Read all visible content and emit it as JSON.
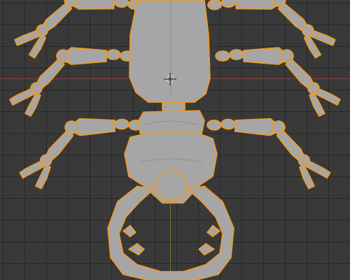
{
  "viewport": {
    "background_color": "#393939",
    "grid_color": "#2e2e2e",
    "x_axis_color": "#8b3a3a",
    "y_axis_color": "#5e7f36"
  },
  "selection": {
    "outline_color": "#f39a1e",
    "mesh_color": "#a6a6a6",
    "shadow_color": "#7f7f7f"
  },
  "origin_marker": {
    "icon": "crosshair-icon"
  }
}
